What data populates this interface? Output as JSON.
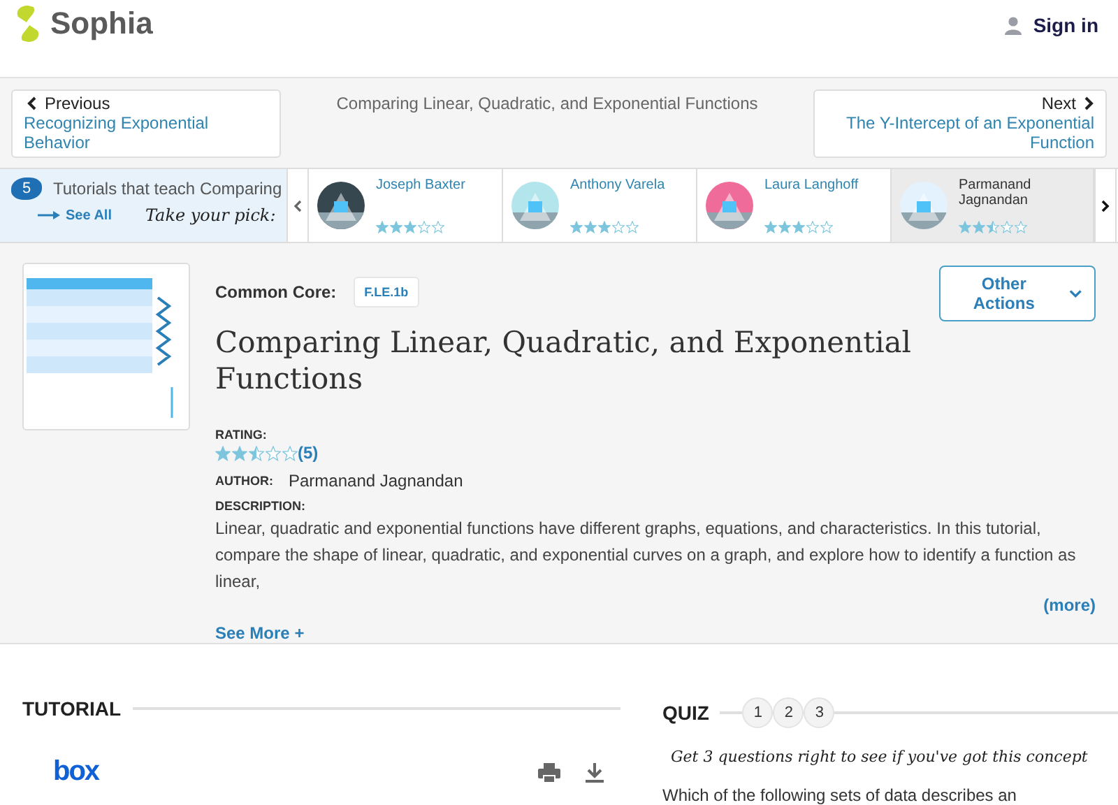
{
  "header": {
    "logo": "Sophia",
    "sign_in": "Sign in"
  },
  "nav": {
    "previous_label": "Previous",
    "previous_title": "Recognizing Exponential Behavior",
    "current": "Comparing Linear, Quadratic, and Exponential Functions",
    "next_label": "Next",
    "next_title": "The Y-Intercept of an Exponential Function"
  },
  "tutorials": {
    "count": "5",
    "title": "Tutorials that teach Comparing",
    "see_all": "See All",
    "tagline": "Take your pick:",
    "items": [
      {
        "author": "Joseph Baxter",
        "stars": 3,
        "selected": false
      },
      {
        "author": "Anthony Varela",
        "stars": 3,
        "selected": false
      },
      {
        "author": "Laura Langhoff",
        "stars": 3,
        "selected": false
      },
      {
        "author": "Parmanand Jagnandan",
        "stars": 2.5,
        "selected": true
      }
    ]
  },
  "detail": {
    "common_core_label": "Common Core:",
    "standard": "F.LE.1b",
    "other_actions": "Other Actions",
    "title": "Comparing Linear, Quadratic, and Exponential Functions",
    "rating_label": "RATING:",
    "stars": 2.5,
    "rating_count": "(5)",
    "author_label": "AUTHOR:",
    "author": "Parmanand Jagnandan",
    "description_label": "DESCRIPTION:",
    "description": "Linear, quadratic and exponential functions have different graphs, equations, and characteristics. In this tutorial, compare the shape of linear, quadratic, and exponential curves on a graph, and explore how to identify a function as linear,",
    "more": "(more)",
    "see_more": "See More +"
  },
  "tutorial": {
    "heading": "TUTORIAL",
    "provider": "box"
  },
  "quiz": {
    "heading": "QUIZ",
    "steps": [
      "1",
      "2",
      "3"
    ],
    "prompt": "Get 3 questions right to see if you've got this concept",
    "question": "Which of the following sets of data describes an"
  }
}
